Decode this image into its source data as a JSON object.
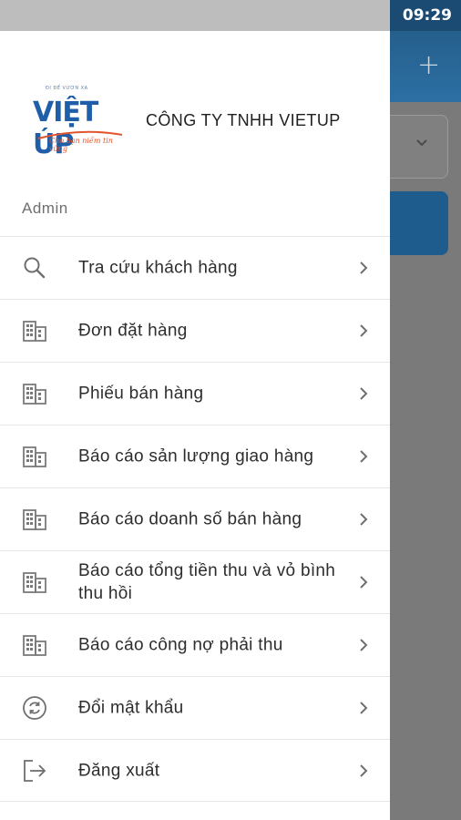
{
  "status_bar": {
    "time": "09:29"
  },
  "background_app": {
    "add_icon": "+",
    "select_caret": "⌄"
  },
  "header": {
    "company_name": "CÔNG TY TNHH VIETUP",
    "logo": {
      "tagline": "ĐI ĐỂ VƯƠN XA",
      "brand": "VIỆT ÚP",
      "slogan": "Cho bạn niềm tin vững"
    },
    "user_name": "Admin"
  },
  "menu": [
    {
      "label": "Tra cứu khách hàng",
      "icon": "search-icon"
    },
    {
      "label": "Đơn đặt hàng",
      "icon": "building-icon"
    },
    {
      "label": "Phiếu bán hàng",
      "icon": "building-icon"
    },
    {
      "label": "Báo cáo sản lượng giao hàng",
      "icon": "building-icon"
    },
    {
      "label": "Báo cáo doanh số bán hàng",
      "icon": "building-icon"
    },
    {
      "label": "Báo cáo tổng tiền thu và vỏ bình thu hồi",
      "icon": "building-icon"
    },
    {
      "label": "Báo cáo công nợ phải thu",
      "icon": "building-icon"
    },
    {
      "label": "Đổi mật khẩu",
      "icon": "sync-icon"
    },
    {
      "label": "Đăng xuất",
      "icon": "logout-icon"
    }
  ],
  "colors": {
    "primary": "#2a6ea1",
    "statusbar": "#1b4a73",
    "brand_blue": "#1f5ea8",
    "brand_orange": "#e2562f"
  }
}
